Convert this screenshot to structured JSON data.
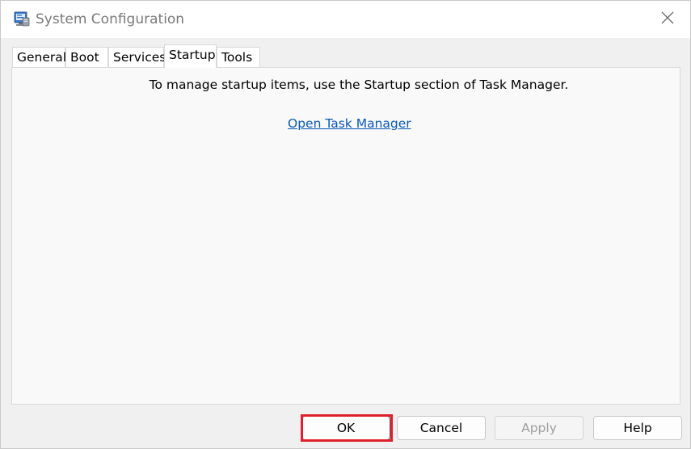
{
  "window": {
    "title": "System Configuration"
  },
  "tabs": [
    {
      "label": "General",
      "active": false
    },
    {
      "label": "Boot",
      "active": false
    },
    {
      "label": "Services",
      "active": false
    },
    {
      "label": "Startup",
      "active": true
    },
    {
      "label": "Tools",
      "active": false
    }
  ],
  "startup": {
    "message": "To manage startup items, use the Startup section of Task Manager.",
    "link_text": "Open Task Manager"
  },
  "buttons": {
    "ok": "OK",
    "cancel": "Cancel",
    "apply": "Apply",
    "help": "Help"
  },
  "icons": {
    "app": "msconfig-icon",
    "close": "close-icon"
  },
  "colors": {
    "link": "#0a58b5",
    "highlight": "#e0202a"
  }
}
